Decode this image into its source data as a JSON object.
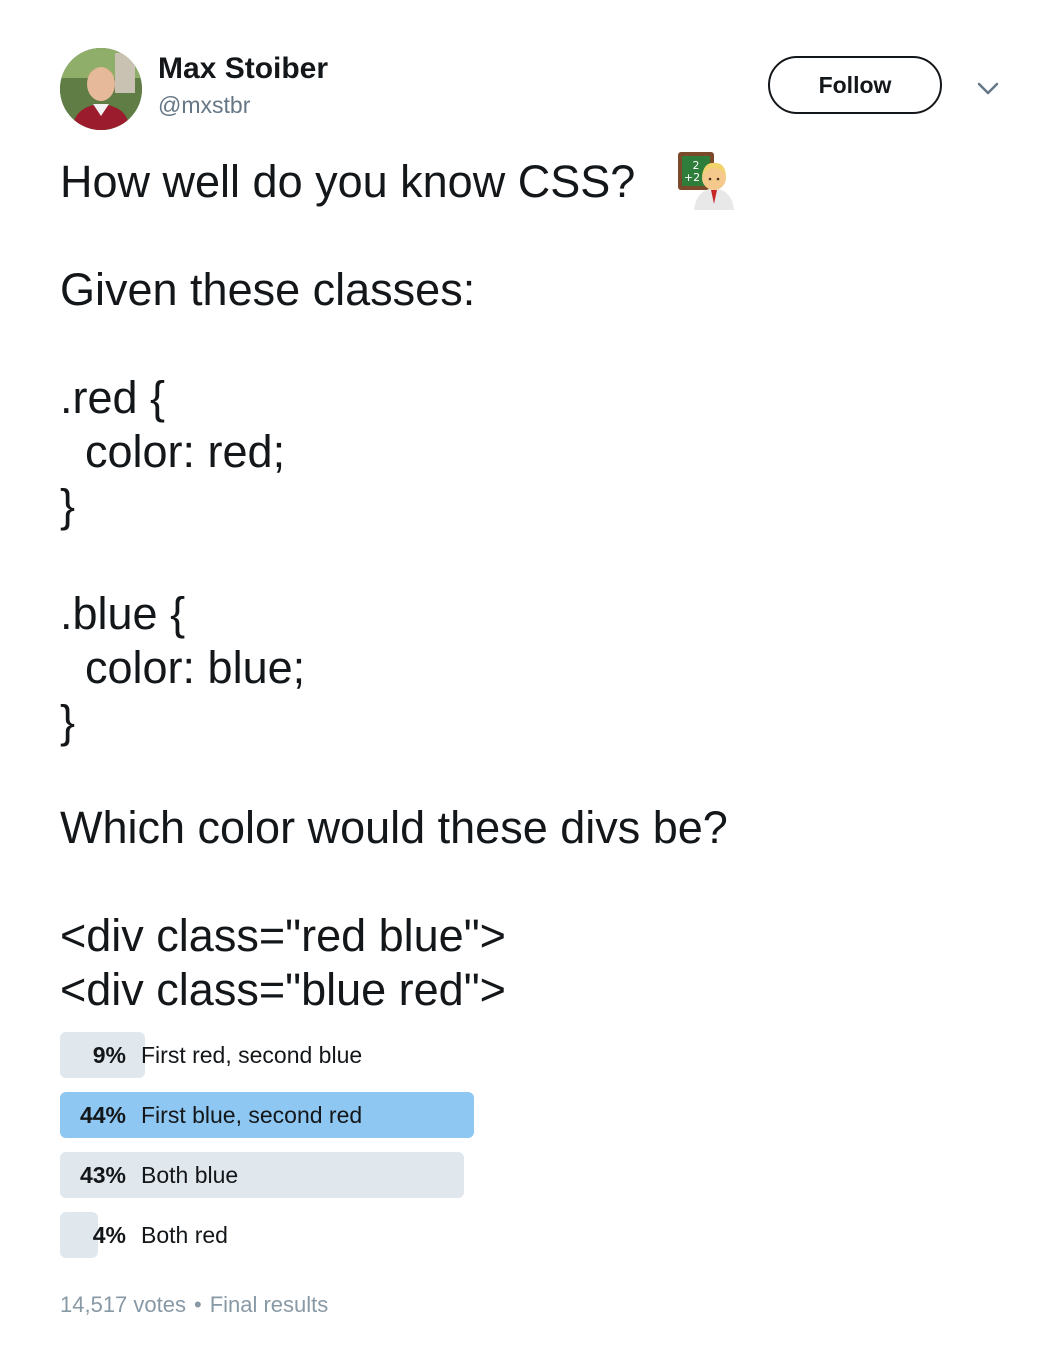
{
  "author": {
    "name": "Max Stoiber",
    "handle": "@mxstbr"
  },
  "actions": {
    "follow_label": "Follow",
    "more_icon": "chevron-down-icon"
  },
  "tweet": {
    "lines": [
      "How well do you know CSS?",
      "Given these classes:",
      ".red {",
      "  color: red;",
      "}",
      ".blue {",
      "  color: blue;",
      "}",
      "Which color would these divs be?",
      "<div class=\"red blue\">",
      "<div class=\"blue red\">"
    ],
    "emoji": "teacher-emoji"
  },
  "poll": {
    "options": [
      {
        "percent_label": "9%",
        "percent": 9,
        "label": "First red, second blue",
        "winner": false
      },
      {
        "percent_label": "44%",
        "percent": 44,
        "label": "First blue, second red",
        "winner": true
      },
      {
        "percent_label": "43%",
        "percent": 43,
        "label": "Both blue",
        "winner": false
      },
      {
        "percent_label": "4%",
        "percent": 4,
        "label": "Both red",
        "winner": false
      }
    ],
    "votes": "14,517 votes",
    "separator": "•",
    "status": "Final results"
  },
  "colors": {
    "winner_bar": "#8ec7f2",
    "other_bar": "#e1e8ed",
    "muted_text": "#8899a6"
  }
}
